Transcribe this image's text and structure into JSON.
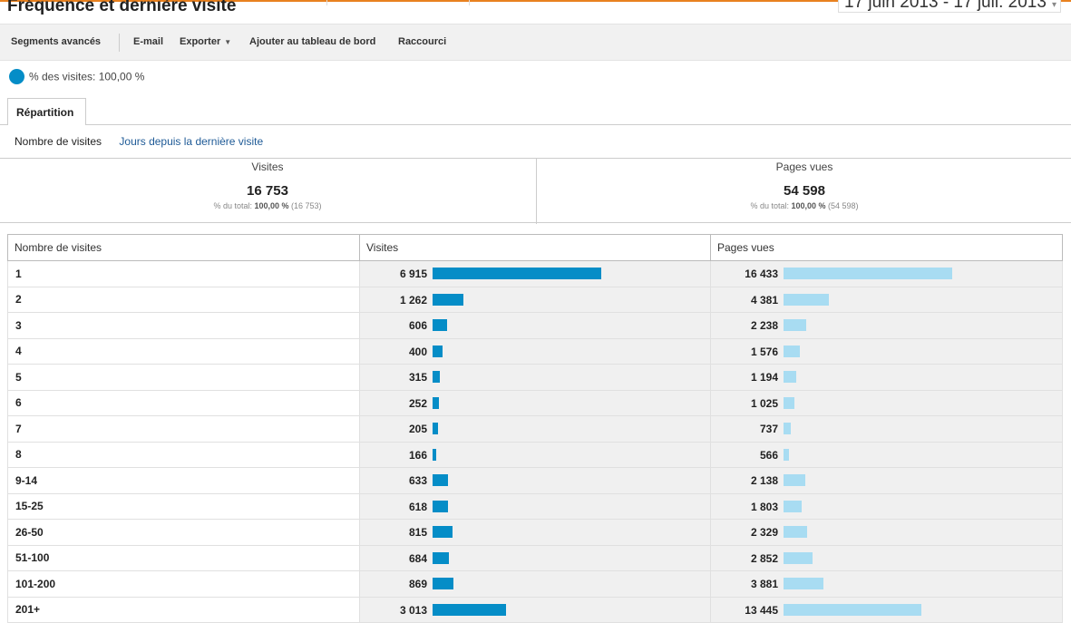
{
  "page": {
    "title": "Fréquence et dernière visite",
    "date_range": "17 juin 2013 - 17 juil. 2013"
  },
  "toolbar": {
    "segments_label": "Segments avancés",
    "email_label": "E-mail",
    "export_label": "Exporter",
    "dashboard_label": "Ajouter au tableau de bord",
    "shortcut_label": "Raccourci"
  },
  "segment": {
    "label": "% des visites: 100,00 %"
  },
  "tabs": {
    "active": "Répartition"
  },
  "subnav": {
    "current": "Nombre de visites",
    "link": "Jours depuis la dernière visite"
  },
  "summary": {
    "visits": {
      "title": "Visites",
      "value": "16 753",
      "pct_label": "% du total: ",
      "pct": "100,00 %",
      "total": "(16 753)"
    },
    "pageviews": {
      "title": "Pages vues",
      "value": "54 598",
      "pct_label": "% du total: ",
      "pct": "100,00 %",
      "total": "(54 598)"
    }
  },
  "table": {
    "headers": [
      "Nombre de visites",
      "Visites",
      "Pages vues"
    ],
    "rows": [
      {
        "label": "1",
        "visits": "6 915",
        "visits_n": 6915,
        "pages": "16 433",
        "pages_n": 16433
      },
      {
        "label": "2",
        "visits": "1 262",
        "visits_n": 1262,
        "pages": "4 381",
        "pages_n": 4381
      },
      {
        "label": "3",
        "visits": "606",
        "visits_n": 606,
        "pages": "2 238",
        "pages_n": 2238
      },
      {
        "label": "4",
        "visits": "400",
        "visits_n": 400,
        "pages": "1 576",
        "pages_n": 1576
      },
      {
        "label": "5",
        "visits": "315",
        "visits_n": 315,
        "pages": "1 194",
        "pages_n": 1194
      },
      {
        "label": "6",
        "visits": "252",
        "visits_n": 252,
        "pages": "1 025",
        "pages_n": 1025
      },
      {
        "label": "7",
        "visits": "205",
        "visits_n": 205,
        "pages": "737",
        "pages_n": 737
      },
      {
        "label": "8",
        "visits": "166",
        "visits_n": 166,
        "pages": "566",
        "pages_n": 566
      },
      {
        "label": "9-14",
        "visits": "633",
        "visits_n": 633,
        "pages": "2 138",
        "pages_n": 2138
      },
      {
        "label": "15-25",
        "visits": "618",
        "visits_n": 618,
        "pages": "1 803",
        "pages_n": 1803
      },
      {
        "label": "26-50",
        "visits": "815",
        "visits_n": 815,
        "pages": "2 329",
        "pages_n": 2329
      },
      {
        "label": "51-100",
        "visits": "684",
        "visits_n": 684,
        "pages": "2 852",
        "pages_n": 2852
      },
      {
        "label": "101-200",
        "visits": "869",
        "visits_n": 869,
        "pages": "3 881",
        "pages_n": 3881
      },
      {
        "label": "201+",
        "visits": "3 013",
        "visits_n": 3013,
        "pages": "13 445",
        "pages_n": 13445
      }
    ]
  },
  "colors": {
    "visits_bar": "#058dc7",
    "pages_bar": "#a8dcf2",
    "accent": "#e8811f"
  }
}
